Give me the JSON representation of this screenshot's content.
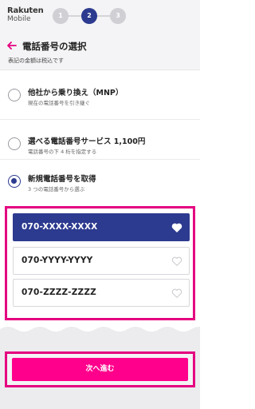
{
  "header": {
    "logo_line1": "Rakuten",
    "logo_line2": "Mobile",
    "steps": [
      "1",
      "2",
      "3"
    ],
    "active_step": "2"
  },
  "page": {
    "title": "電話番号の選択",
    "tax_note": "表記の金額は税込です"
  },
  "options": [
    {
      "title": "他社から乗り換え（MNP）",
      "subtitle": "現在の電話番号を引き継ぐ",
      "selected": false
    },
    {
      "title": "選べる電話番号サービス 1,100円",
      "subtitle": "電話番号の下 4 桁を指定する",
      "selected": false
    },
    {
      "title": "新規電話番号を取得",
      "subtitle": "3 つの電話番号から選ぶ",
      "selected": true
    }
  ],
  "numbers": [
    {
      "value": "070-XXXX-XXXX",
      "selected": true,
      "icon": "heart-icon"
    },
    {
      "value": "070-YYYY-YYYY",
      "selected": false,
      "icon": "heart-outline-icon"
    },
    {
      "value": "070-ZZZZ-ZZZZ",
      "selected": false,
      "icon": "heart-outline-icon"
    }
  ],
  "next_button": {
    "label": "次へ進む"
  },
  "colors": {
    "brand_magenta": "#ff008c",
    "highlight_border": "#e4007f",
    "navy": "#2c3a8f"
  }
}
